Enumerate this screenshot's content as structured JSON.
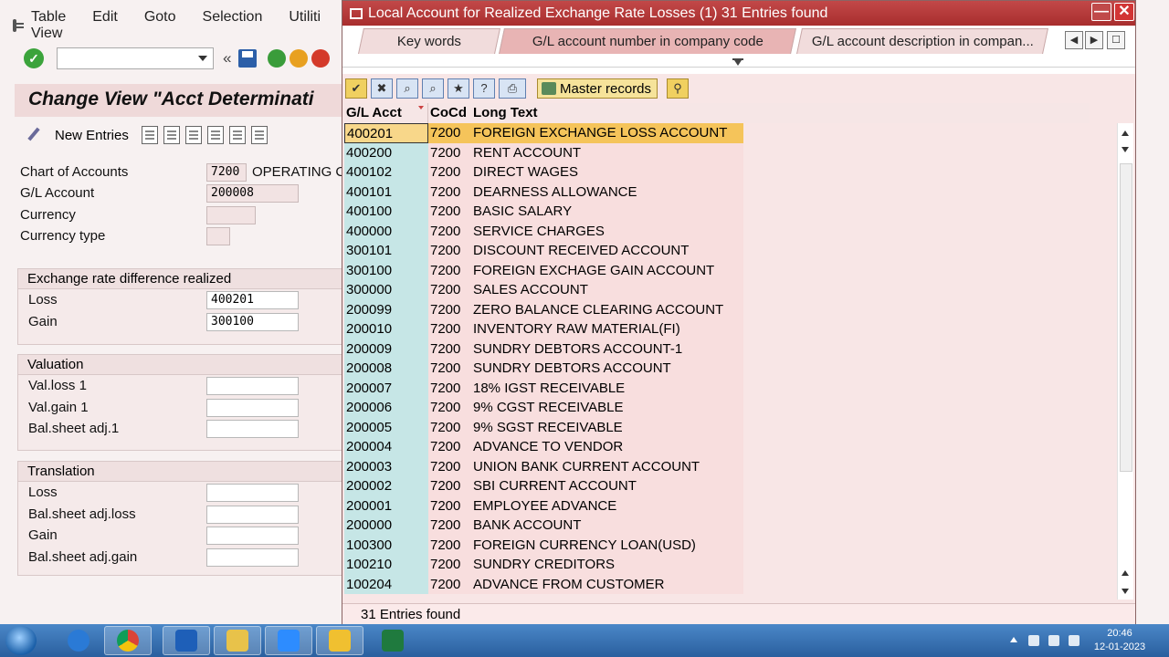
{
  "menubar": {
    "items": [
      "Table View",
      "Edit",
      "Goto",
      "Selection",
      "Utiliti"
    ]
  },
  "toolbar": {
    "back_glyph": "«"
  },
  "view": {
    "title": "Change View \"Acct Determinati",
    "new_entries_label": "New Entries"
  },
  "header_fields": {
    "chart_of_accounts": {
      "label": "Chart of Accounts",
      "value": "7200",
      "text": "OPERATING C"
    },
    "gl_account": {
      "label": "G/L Account",
      "value": "200008"
    },
    "currency": {
      "label": "Currency",
      "value": ""
    },
    "currency_type": {
      "label": "Currency type",
      "value": ""
    }
  },
  "groups": {
    "realized": {
      "title": "Exchange rate difference realized",
      "loss_label": "Loss",
      "loss_value": "400201",
      "gain_label": "Gain",
      "gain_value": "300100"
    },
    "valuation": {
      "title": "Valuation",
      "rows": [
        "Val.loss 1",
        "Val.gain 1",
        "Bal.sheet adj.1"
      ]
    },
    "translation": {
      "title": "Translation",
      "rows": [
        "Loss",
        "Bal.sheet adj.loss",
        "Gain",
        "Bal.sheet adj.gain"
      ]
    }
  },
  "popup": {
    "title": "Local Account for Realized Exchange Rate Losses (1)   31 Entries found",
    "minimize_glyph": "—",
    "close_glyph": "✕",
    "tabs": [
      "Key words",
      "G/L account number in company code",
      "G/L account description in compan..."
    ],
    "tab_nav": [
      "◀",
      "▶",
      "☐"
    ],
    "master_records_label": "Master records",
    "toolbar_buttons": [
      "✔",
      "✖",
      "⌕",
      "⌕",
      "★",
      "?",
      "⎙",
      "⚲"
    ],
    "columns": {
      "acct": "G/L Acct",
      "cocd": "CoCd",
      "text": "Long Text"
    },
    "rows": [
      {
        "acct": "400201",
        "cocd": "7200",
        "text": "FOREIGN EXCHANGE LOSS ACCOUNT"
      },
      {
        "acct": "400200",
        "cocd": "7200",
        "text": "RENT ACCOUNT"
      },
      {
        "acct": "400102",
        "cocd": "7200",
        "text": "DIRECT WAGES"
      },
      {
        "acct": "400101",
        "cocd": "7200",
        "text": "DEARNESS ALLOWANCE"
      },
      {
        "acct": "400100",
        "cocd": "7200",
        "text": "BASIC SALARY"
      },
      {
        "acct": "400000",
        "cocd": "7200",
        "text": "SERVICE CHARGES"
      },
      {
        "acct": "300101",
        "cocd": "7200",
        "text": "DISCOUNT RECEIVED ACCOUNT"
      },
      {
        "acct": "300100",
        "cocd": "7200",
        "text": "FOREIGN EXCHAGE GAIN ACCOUNT"
      },
      {
        "acct": "300000",
        "cocd": "7200",
        "text": "SALES ACCOUNT"
      },
      {
        "acct": "200099",
        "cocd": "7200",
        "text": "ZERO BALANCE CLEARING ACCOUNT"
      },
      {
        "acct": "200010",
        "cocd": "7200",
        "text": "INVENTORY RAW MATERIAL(FI)"
      },
      {
        "acct": "200009",
        "cocd": "7200",
        "text": "SUNDRY DEBTORS ACCOUNT-1"
      },
      {
        "acct": "200008",
        "cocd": "7200",
        "text": "SUNDRY DEBTORS ACCOUNT"
      },
      {
        "acct": "200007",
        "cocd": "7200",
        "text": "18% IGST RECEIVABLE"
      },
      {
        "acct": "200006",
        "cocd": "7200",
        "text": "9% CGST RECEIVABLE"
      },
      {
        "acct": "200005",
        "cocd": "7200",
        "text": "9% SGST RECEIVABLE"
      },
      {
        "acct": "200004",
        "cocd": "7200",
        "text": "ADVANCE TO VENDOR"
      },
      {
        "acct": "200003",
        "cocd": "7200",
        "text": "UNION BANK CURRENT ACCOUNT"
      },
      {
        "acct": "200002",
        "cocd": "7200",
        "text": "SBI CURRENT ACCOUNT"
      },
      {
        "acct": "200001",
        "cocd": "7200",
        "text": "EMPLOYEE ADVANCE"
      },
      {
        "acct": "200000",
        "cocd": "7200",
        "text": "BANK ACCOUNT"
      },
      {
        "acct": "100300",
        "cocd": "7200",
        "text": "FOREIGN CURRENCY LOAN(USD)"
      },
      {
        "acct": "100210",
        "cocd": "7200",
        "text": "SUNDRY CREDITORS"
      },
      {
        "acct": "100204",
        "cocd": "7200",
        "text": "ADVANCE FROM CUSTOMER"
      }
    ],
    "status": "31 Entries found"
  },
  "taskbar": {
    "apps": [
      "internet-explorer",
      "chrome",
      "outlook",
      "file-explorer",
      "zoom",
      "sap-logon",
      "excel"
    ],
    "time": "20:46",
    "date": "12-01-2023"
  }
}
